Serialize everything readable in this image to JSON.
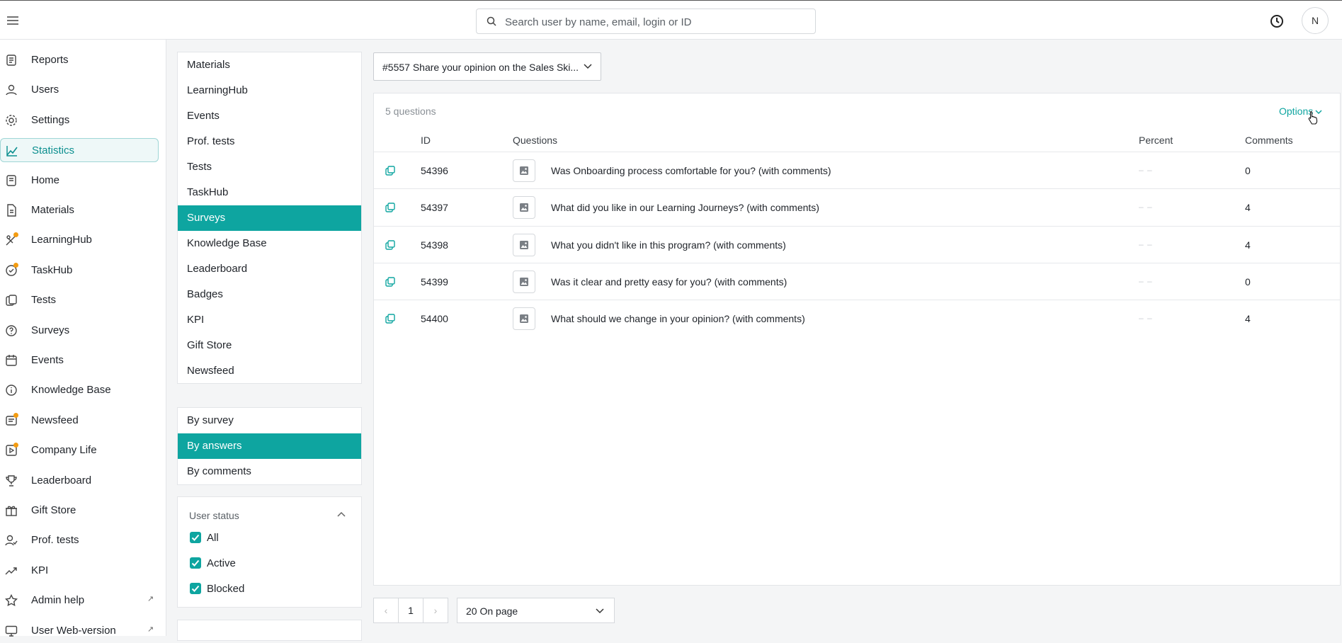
{
  "topbar": {
    "search_placeholder": "Search user by name, email, login or ID",
    "avatar_initial": "N"
  },
  "nav": {
    "items": [
      {
        "label": "Reports",
        "icon": "reports-icon"
      },
      {
        "label": "Users",
        "icon": "users-icon"
      },
      {
        "label": "Settings",
        "icon": "settings-icon"
      },
      {
        "label": "Statistics",
        "icon": "statistics-icon",
        "active": true
      },
      {
        "label": "Home",
        "icon": "home-icon"
      },
      {
        "label": "Materials",
        "icon": "materials-icon"
      },
      {
        "label": "LearningHub",
        "icon": "learninghub-icon",
        "badge": true
      },
      {
        "label": "TaskHub",
        "icon": "taskhub-icon",
        "badge": true
      },
      {
        "label": "Tests",
        "icon": "tests-icon"
      },
      {
        "label": "Surveys",
        "icon": "surveys-icon"
      },
      {
        "label": "Events",
        "icon": "events-icon"
      },
      {
        "label": "Knowledge Base",
        "icon": "knowledge-base-icon"
      },
      {
        "label": "Newsfeed",
        "icon": "newsfeed-icon",
        "badge": true
      },
      {
        "label": "Company Life",
        "icon": "company-life-icon",
        "badge": true
      },
      {
        "label": "Leaderboard",
        "icon": "trophy-icon"
      },
      {
        "label": "Gift Store",
        "icon": "gift-icon"
      },
      {
        "label": "Prof. tests",
        "icon": "prof-tests-icon"
      },
      {
        "label": "KPI",
        "icon": "kpi-trend-icon"
      },
      {
        "label": "Admin help",
        "icon": "star-icon",
        "external": true
      },
      {
        "label": "User Web-version",
        "icon": "monitor-icon",
        "external": true
      }
    ],
    "external_glyph": "↗"
  },
  "sections": {
    "items": [
      "Materials",
      "LearningHub",
      "Events",
      "Prof. tests",
      "Tests",
      "TaskHub",
      "Surveys",
      "Knowledge Base",
      "Leaderboard",
      "Badges",
      "KPI",
      "Gift Store",
      "Newsfeed"
    ],
    "selected": "Surveys"
  },
  "views": {
    "items": [
      "By survey",
      "By answers",
      "By comments"
    ],
    "selected": "By answers"
  },
  "user_status": {
    "title": "User status",
    "options": [
      {
        "label": "All",
        "checked": true
      },
      {
        "label": "Active",
        "checked": true
      },
      {
        "label": "Blocked",
        "checked": true
      }
    ]
  },
  "survey_select": {
    "value": "#5557 Share your opinion on the Sales Ski..."
  },
  "table": {
    "count_label": "5 questions",
    "options_label": "Options",
    "headers": {
      "id": "ID",
      "questions": "Questions",
      "percent": "Percent",
      "comments": "Comments"
    },
    "rows": [
      {
        "id": "54396",
        "question": "Was Onboarding process comfortable for you? (with comments)",
        "percent": "– –",
        "comments": "0"
      },
      {
        "id": "54397",
        "question": "What did you like in our Learning Journeys? (with comments)",
        "percent": "– –",
        "comments": "4"
      },
      {
        "id": "54398",
        "question": "What you didn't like in this program? (with comments)",
        "percent": "– –",
        "comments": "4"
      },
      {
        "id": "54399",
        "question": "Was it clear and pretty easy for you? (with comments)",
        "percent": "– –",
        "comments": "0"
      },
      {
        "id": "54400",
        "question": "What should we change in your opinion? (with comments)",
        "percent": "– –",
        "comments": "4"
      }
    ]
  },
  "pagination": {
    "prev": "‹",
    "current_page": "1",
    "next": "›",
    "per_page": "20 On page"
  },
  "colors": {
    "accent": "#0ea5a0",
    "badge": "#f39c12"
  }
}
